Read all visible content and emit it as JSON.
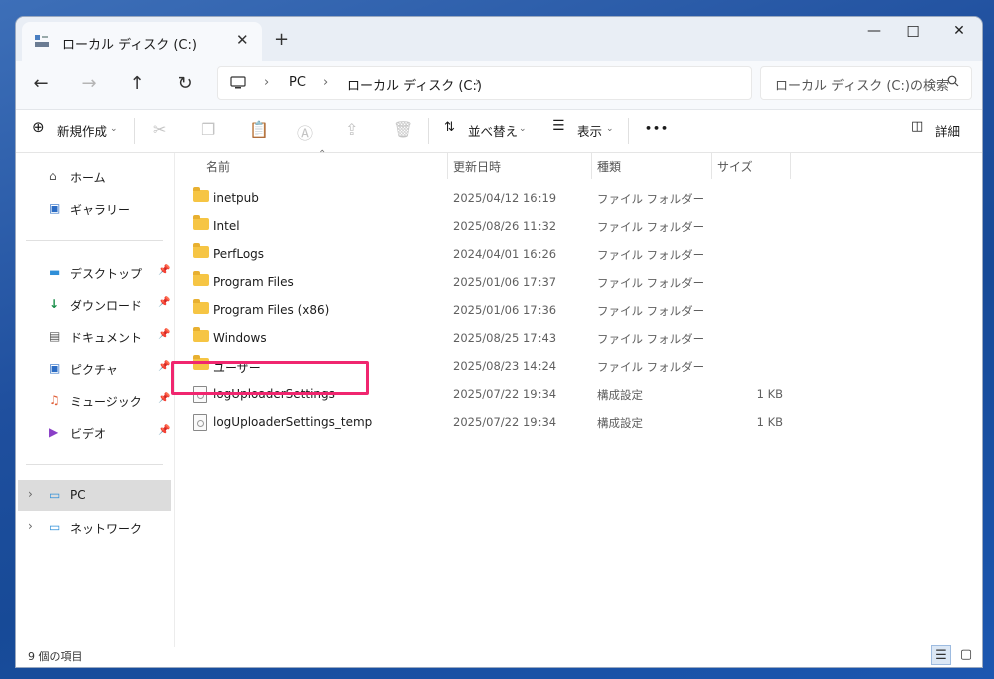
{
  "window": {
    "tab_title": "ローカル ディスク (C:)",
    "new_tab": "+",
    "close_tab": "✕",
    "minimize": "—",
    "maximize": "☐",
    "close": "✕"
  },
  "address": {
    "back": "←",
    "forward": "→",
    "up": "↑",
    "refresh": "↻",
    "crumbs": [
      "PC",
      "ローカル ディスク (C:)"
    ],
    "sep": "›",
    "search_placeholder": "ローカル ディスク (C:)の検索"
  },
  "toolbar": {
    "new_label": "新規作成",
    "sort_label": "並べ替え",
    "view_label": "表示",
    "more_label": "•••",
    "details_label": "詳細"
  },
  "sidebar": {
    "quick": [
      {
        "label": "ホーム",
        "icon": "home-icon",
        "pinned": false
      },
      {
        "label": "ギャラリー",
        "icon": "gallery-icon",
        "pinned": false
      }
    ],
    "pinned": [
      {
        "label": "デスクトップ",
        "icon": "desktop-icon"
      },
      {
        "label": "ダウンロード",
        "icon": "download-icon"
      },
      {
        "label": "ドキュメント",
        "icon": "document-icon"
      },
      {
        "label": "ピクチャ",
        "icon": "picture-icon"
      },
      {
        "label": "ミュージック",
        "icon": "music-icon"
      },
      {
        "label": "ビデオ",
        "icon": "video-icon"
      }
    ],
    "devices": [
      {
        "label": "PC",
        "icon": "pc-icon",
        "selected": true
      },
      {
        "label": "ネットワーク",
        "icon": "network-icon",
        "selected": false
      }
    ]
  },
  "columns": {
    "name": "名前",
    "date": "更新日時",
    "type": "種類",
    "size": "サイズ"
  },
  "files": [
    {
      "name": "inetpub",
      "date": "2025/04/12 16:19",
      "type": "ファイル フォルダー",
      "size": "",
      "kind": "folder"
    },
    {
      "name": "Intel",
      "date": "2025/08/26 11:32",
      "type": "ファイル フォルダー",
      "size": "",
      "kind": "folder"
    },
    {
      "name": "PerfLogs",
      "date": "2024/04/01 16:26",
      "type": "ファイル フォルダー",
      "size": "",
      "kind": "folder"
    },
    {
      "name": "Program Files",
      "date": "2025/01/06 17:37",
      "type": "ファイル フォルダー",
      "size": "",
      "kind": "folder"
    },
    {
      "name": "Program Files (x86)",
      "date": "2025/01/06 17:36",
      "type": "ファイル フォルダー",
      "size": "",
      "kind": "folder"
    },
    {
      "name": "Windows",
      "date": "2025/08/25 17:43",
      "type": "ファイル フォルダー",
      "size": "",
      "kind": "folder"
    },
    {
      "name": "ユーザー",
      "date": "2025/08/23 14:24",
      "type": "ファイル フォルダー",
      "size": "",
      "kind": "folder"
    },
    {
      "name": "logUploaderSettings",
      "date": "2025/07/22 19:34",
      "type": "構成設定",
      "size": "1 KB",
      "kind": "file"
    },
    {
      "name": "logUploaderSettings_temp",
      "date": "2025/07/22 19:34",
      "type": "構成設定",
      "size": "1 KB",
      "kind": "file"
    }
  ],
  "status": {
    "item_count": "9 個の項目"
  },
  "colors": {
    "highlight": "#f0266f",
    "folder": "#f6c544",
    "selected_nav": "#dcdcdc"
  }
}
